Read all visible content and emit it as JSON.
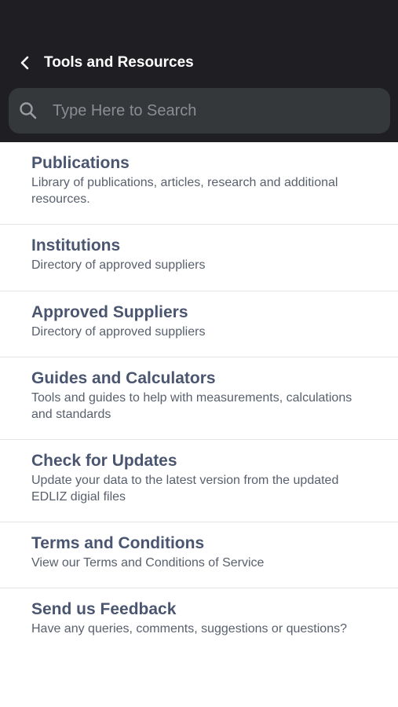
{
  "header": {
    "title": "Tools and Resources",
    "back_icon": "chevron-left-icon",
    "background": "#1f1f23"
  },
  "search": {
    "placeholder": "Type Here to Search",
    "value": "",
    "icon": "search-icon"
  },
  "items": [
    {
      "title": "Publications",
      "description": "Library of publications, articles, research and additional resources."
    },
    {
      "title": "Institutions",
      "description": "Directory of approved suppliers"
    },
    {
      "title": "Approved Suppliers",
      "description": "Directory of approved suppliers"
    },
    {
      "title": "Guides and Calculators",
      "description": "Tools and guides to help with measurements, calculations and standards"
    },
    {
      "title": "Check for Updates",
      "description": "Update your data to the latest version from the updated EDLIZ digial files"
    },
    {
      "title": "Terms and Conditions",
      "description": "View our Terms and Conditions of Service"
    },
    {
      "title": "Send us Feedback",
      "description": "Have any queries, comments, suggestions or questions?"
    }
  ],
  "colors": {
    "title_text": "#4a5570",
    "description_text": "#59606d",
    "divider": "#e2e4e8",
    "search_bg": "#34383b"
  }
}
